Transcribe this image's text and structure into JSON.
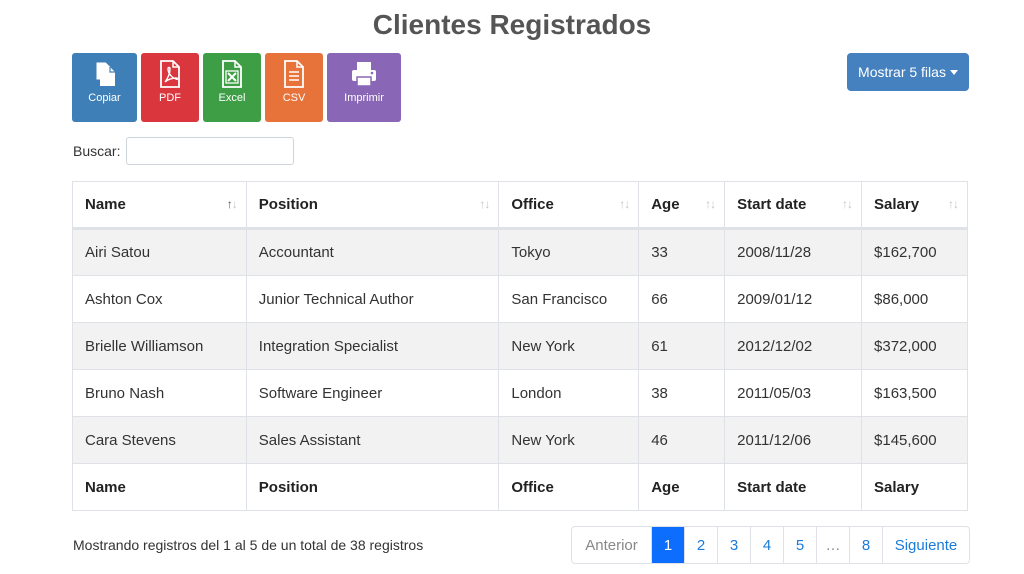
{
  "title": "Clientes Registrados",
  "export_buttons": {
    "copy": {
      "label": "Copiar",
      "color": "#3f7fb8",
      "icon": "copy-icon"
    },
    "pdf": {
      "label": "PDF",
      "color": "#d9363e",
      "icon": "pdf-file-icon"
    },
    "excel": {
      "label": "Excel",
      "color": "#3e9e45",
      "icon": "excel-file-icon"
    },
    "csv": {
      "label": "CSV",
      "color": "#e8733a",
      "icon": "csv-file-icon"
    },
    "print": {
      "label": "Imprimir",
      "color": "#8a67b6",
      "icon": "printer-icon"
    }
  },
  "rows_menu": {
    "label": "Mostrar 5 filas",
    "color": "#4681bf"
  },
  "search": {
    "label": "Buscar:",
    "value": ""
  },
  "table": {
    "columns": [
      "Name",
      "Position",
      "Office",
      "Age",
      "Start date",
      "Salary"
    ],
    "sorted_column": "Name",
    "rows": [
      [
        "Airi Satou",
        "Accountant",
        "Tokyo",
        "33",
        "2008/11/28",
        "$162,700"
      ],
      [
        "Ashton Cox",
        "Junior Technical Author",
        "San Francisco",
        "66",
        "2009/01/12",
        "$86,000"
      ],
      [
        "Brielle Williamson",
        "Integration Specialist",
        "New York",
        "61",
        "2012/12/02",
        "$372,000"
      ],
      [
        "Bruno Nash",
        "Software Engineer",
        "London",
        "38",
        "2011/05/03",
        "$163,500"
      ],
      [
        "Cara Stevens",
        "Sales Assistant",
        "New York",
        "46",
        "2011/12/06",
        "$145,600"
      ]
    ]
  },
  "info": "Mostrando registros del 1 al 5 de un total de 38 registros",
  "pagination": {
    "prev": "Anterior",
    "pages": [
      "1",
      "2",
      "3",
      "4",
      "5",
      "…",
      "8"
    ],
    "active": "1",
    "next": "Siguiente",
    "active_color": "#0d6efd"
  }
}
